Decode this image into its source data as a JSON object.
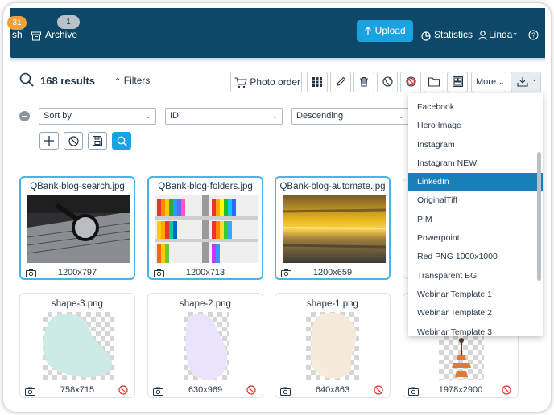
{
  "nav": {
    "trash_label": "sh",
    "trash_badge": "31",
    "archive_label": "Archive",
    "archive_badge": "1",
    "upload_label": "Upload",
    "statistics_label": "Statistics",
    "user_label": "Linda",
    "colors": {
      "topbar": "#0e4868",
      "accent": "#1aa3e0"
    }
  },
  "toolbar": {
    "results": "168 results",
    "filters": "Filters",
    "photo_order": "Photo order",
    "more": "More"
  },
  "sort": {
    "sort_by": "Sort by",
    "field": "ID",
    "direction": "Descending"
  },
  "cards": [
    {
      "name": "QBank-blog-search.jpg",
      "dims": "1200x797"
    },
    {
      "name": "QBank-blog-folders.jpg",
      "dims": "1200x713"
    },
    {
      "name": "QBank-blog-automate.jpg",
      "dims": "1200x659"
    },
    {
      "name": "shape-3.png",
      "dims": "758x715"
    },
    {
      "name": "shape-2.png",
      "dims": "630x969"
    },
    {
      "name": "shape-1.png",
      "dims": "640x863"
    },
    {
      "name": "",
      "dims": "1978x2900"
    }
  ],
  "download_menu": {
    "items": [
      "Facebook",
      "Hero Image",
      "Instagram",
      "Instagram NEW",
      "LinkedIn",
      "OriginalTiff",
      "PIM",
      "Powerpoint",
      "Red PNG 1000x1000",
      "Transparent BG",
      "Webinar Template 1",
      "Webinar Template 2",
      "Webinar Template 3"
    ],
    "active": "LinkedIn"
  }
}
